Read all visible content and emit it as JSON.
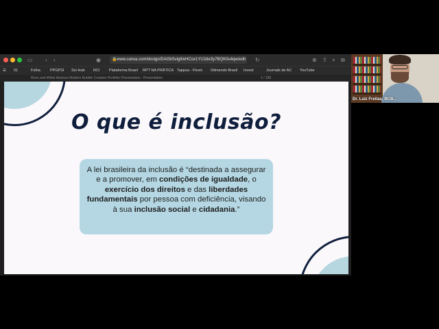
{
  "browser": {
    "url": "www.canva.com/design/DAGbSvigll/eHCox1YU2de3y7BQK0u4qw/edit",
    "tab_title": "Roxo and White Abstract Modern Bubble Creative Portfolio Presentation - Presentation",
    "tab_counter": "1 / 180",
    "bookmarks": [
      "01",
      "Folha",
      "PPGPSI",
      "Sci-Hub",
      "RCI",
      "Plataforma Brasil",
      "RPT NA PRÁTICA",
      "Tappua - Flexiv",
      "Otimendo Brasil",
      "Invest",
      "Journals de AC",
      "YouTube"
    ]
  },
  "slide": {
    "title": "O que é inclusão?",
    "quote_parts": [
      {
        "text": "A lei brasileira da inclusão é “destinada a assegurar e a promover, em ",
        "bold": false
      },
      {
        "text": "condições de igualdade",
        "bold": true
      },
      {
        "text": ", o ",
        "bold": false
      },
      {
        "text": "exercício dos direitos",
        "bold": true
      },
      {
        "text": " e das ",
        "bold": false
      },
      {
        "text": "liberdades fundamentais",
        "bold": true
      },
      {
        "text": " por pessoa com deficiência, visando à sua ",
        "bold": false
      },
      {
        "text": "inclusão social",
        "bold": true
      },
      {
        "text": " e ",
        "bold": false
      },
      {
        "text": "cidadania",
        "bold": true
      },
      {
        "text": ".”",
        "bold": false
      }
    ]
  },
  "video": {
    "participant_name": "Dr. Luiz Freitas, BCB..."
  },
  "colors": {
    "slide_bg": "#fbf8fb",
    "accent_blue": "#b6d6e0",
    "navy": "#0f1e3c"
  }
}
